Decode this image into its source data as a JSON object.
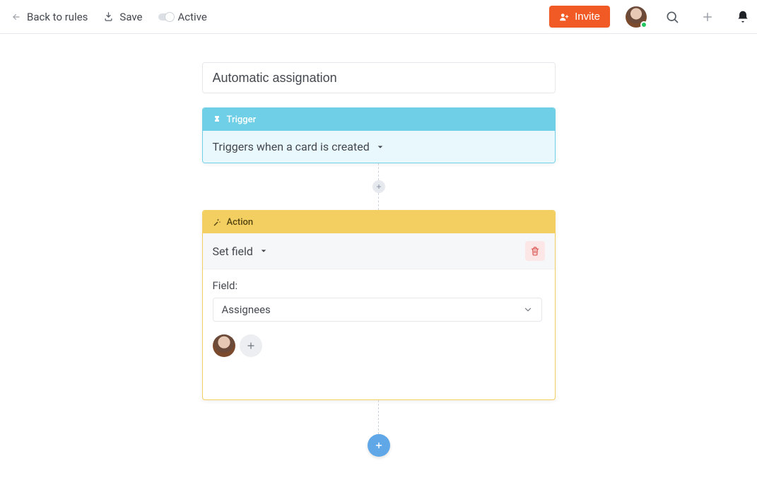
{
  "header": {
    "back_label": "Back to rules",
    "save_label": "Save",
    "active_label": "Active",
    "invite_label": "Invite"
  },
  "rule": {
    "title": "Automatic assignation"
  },
  "trigger": {
    "section_label": "Trigger",
    "selected": "Triggers when a card is created"
  },
  "action": {
    "section_label": "Action",
    "type_selected": "Set field",
    "field_label": "Field:",
    "field_selected": "Assignees"
  }
}
